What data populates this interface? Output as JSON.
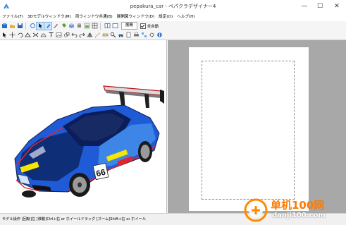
{
  "window": {
    "title": "pepakura_car - ペパクラデザイナー4",
    "minimize": "—",
    "maximize": "☐",
    "close": "✕"
  },
  "menu": {
    "items": [
      "ファイル(F)",
      "3Dモデルウィンドウ(M)",
      "両ウィンドウ共通(B)",
      "展開図ウィンドウ(D)",
      "設定(O)",
      "ヘルプ(H)"
    ]
  },
  "toolbar": {
    "unfold_button": "展開",
    "auto_checkbox_label": "全自動",
    "auto_checked": true
  },
  "status": {
    "text": "モデル操作 [回転]左 [移動]Ctrl+右 or ホイールドラッグ [ズーム]Shift+右 or ホイール"
  },
  "car": {
    "number": "66",
    "body_color": "#1f5bd6",
    "dark_color": "#0b1d5a",
    "accent_color": "#e1262b"
  },
  "watermark": {
    "cn": "单机100网",
    "url": "danji100.com"
  }
}
